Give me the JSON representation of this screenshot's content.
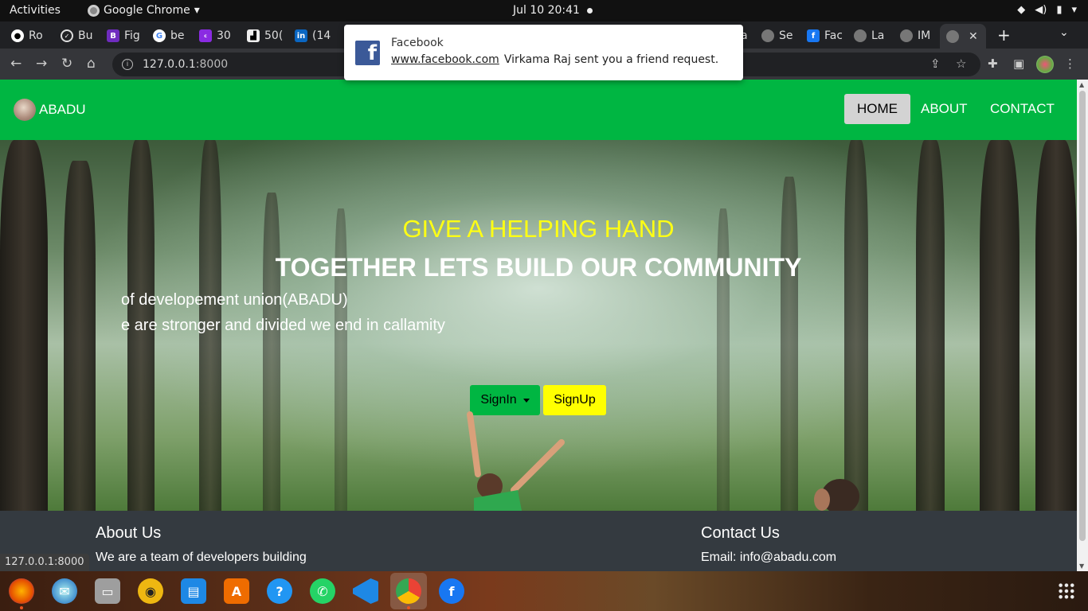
{
  "system_bar": {
    "activities": "Activities",
    "app_name": "Google Chrome",
    "clock": "Jul 10  20:41"
  },
  "tabs": [
    {
      "label": "Ro",
      "icon": "github-icon"
    },
    {
      "label": "Bu",
      "icon": "circle-check-icon"
    },
    {
      "label": "Fig",
      "icon": "bootstrap-icon"
    },
    {
      "label": "be",
      "icon": "google-icon"
    },
    {
      "label": "30",
      "icon": "colorlib-icon"
    },
    {
      "label": "50(",
      "icon": "figma-like-icon"
    },
    {
      "label": "(14",
      "icon": "linkedin-icon"
    },
    {
      "label": "a",
      "icon": "tab-icon"
    },
    {
      "label": "Se",
      "icon": "globe-icon"
    },
    {
      "label": "Fac",
      "icon": "facebook-icon"
    },
    {
      "label": "La",
      "icon": "globe-icon"
    },
    {
      "label": "IM",
      "icon": "globe-icon"
    },
    {
      "label": "",
      "icon": "globe-icon",
      "active": true
    }
  ],
  "toolbar": {
    "url_host": "127.0.0.1",
    "url_port": ":8000"
  },
  "notification": {
    "app": "Facebook",
    "site": "www.facebook.com",
    "message": "Virkama Raj sent you a friend request."
  },
  "site": {
    "brand": "ABADU",
    "nav": [
      {
        "label": "HOME",
        "active": true
      },
      {
        "label": "ABOUT",
        "active": false
      },
      {
        "label": "CONTACT",
        "active": false
      }
    ],
    "hero": {
      "subtitle": "GIVE A HELPING HAND",
      "headline": "TOGETHER LETS BUILD OUR COMMUNITY",
      "line1": "of developement union(ABADU)",
      "line2": "e are stronger and divided we end in callamity",
      "signin": "SignIn",
      "signup": "SignUp"
    },
    "footer": {
      "about_title": "About Us",
      "about_text": "We are a team of developers building",
      "contact_title": "Contact Us",
      "contact_email": "Email: info@abadu.com"
    }
  },
  "status_url": "127.0.0.1:8000",
  "colors": {
    "navbar": "#00b642",
    "hero_subtitle": "#ffff14",
    "signup": "#ffff00",
    "footer": "#343a40"
  },
  "dock": [
    {
      "name": "firefox",
      "running": true
    },
    {
      "name": "thunderbird",
      "running": false
    },
    {
      "name": "files",
      "running": false
    },
    {
      "name": "rhythmbox",
      "running": false
    },
    {
      "name": "writer",
      "running": false
    },
    {
      "name": "software",
      "running": false
    },
    {
      "name": "help",
      "running": false
    },
    {
      "name": "whatsapp",
      "running": false
    },
    {
      "name": "vscode",
      "running": true
    },
    {
      "name": "chrome",
      "running": true
    },
    {
      "name": "facebook",
      "running": false
    }
  ]
}
